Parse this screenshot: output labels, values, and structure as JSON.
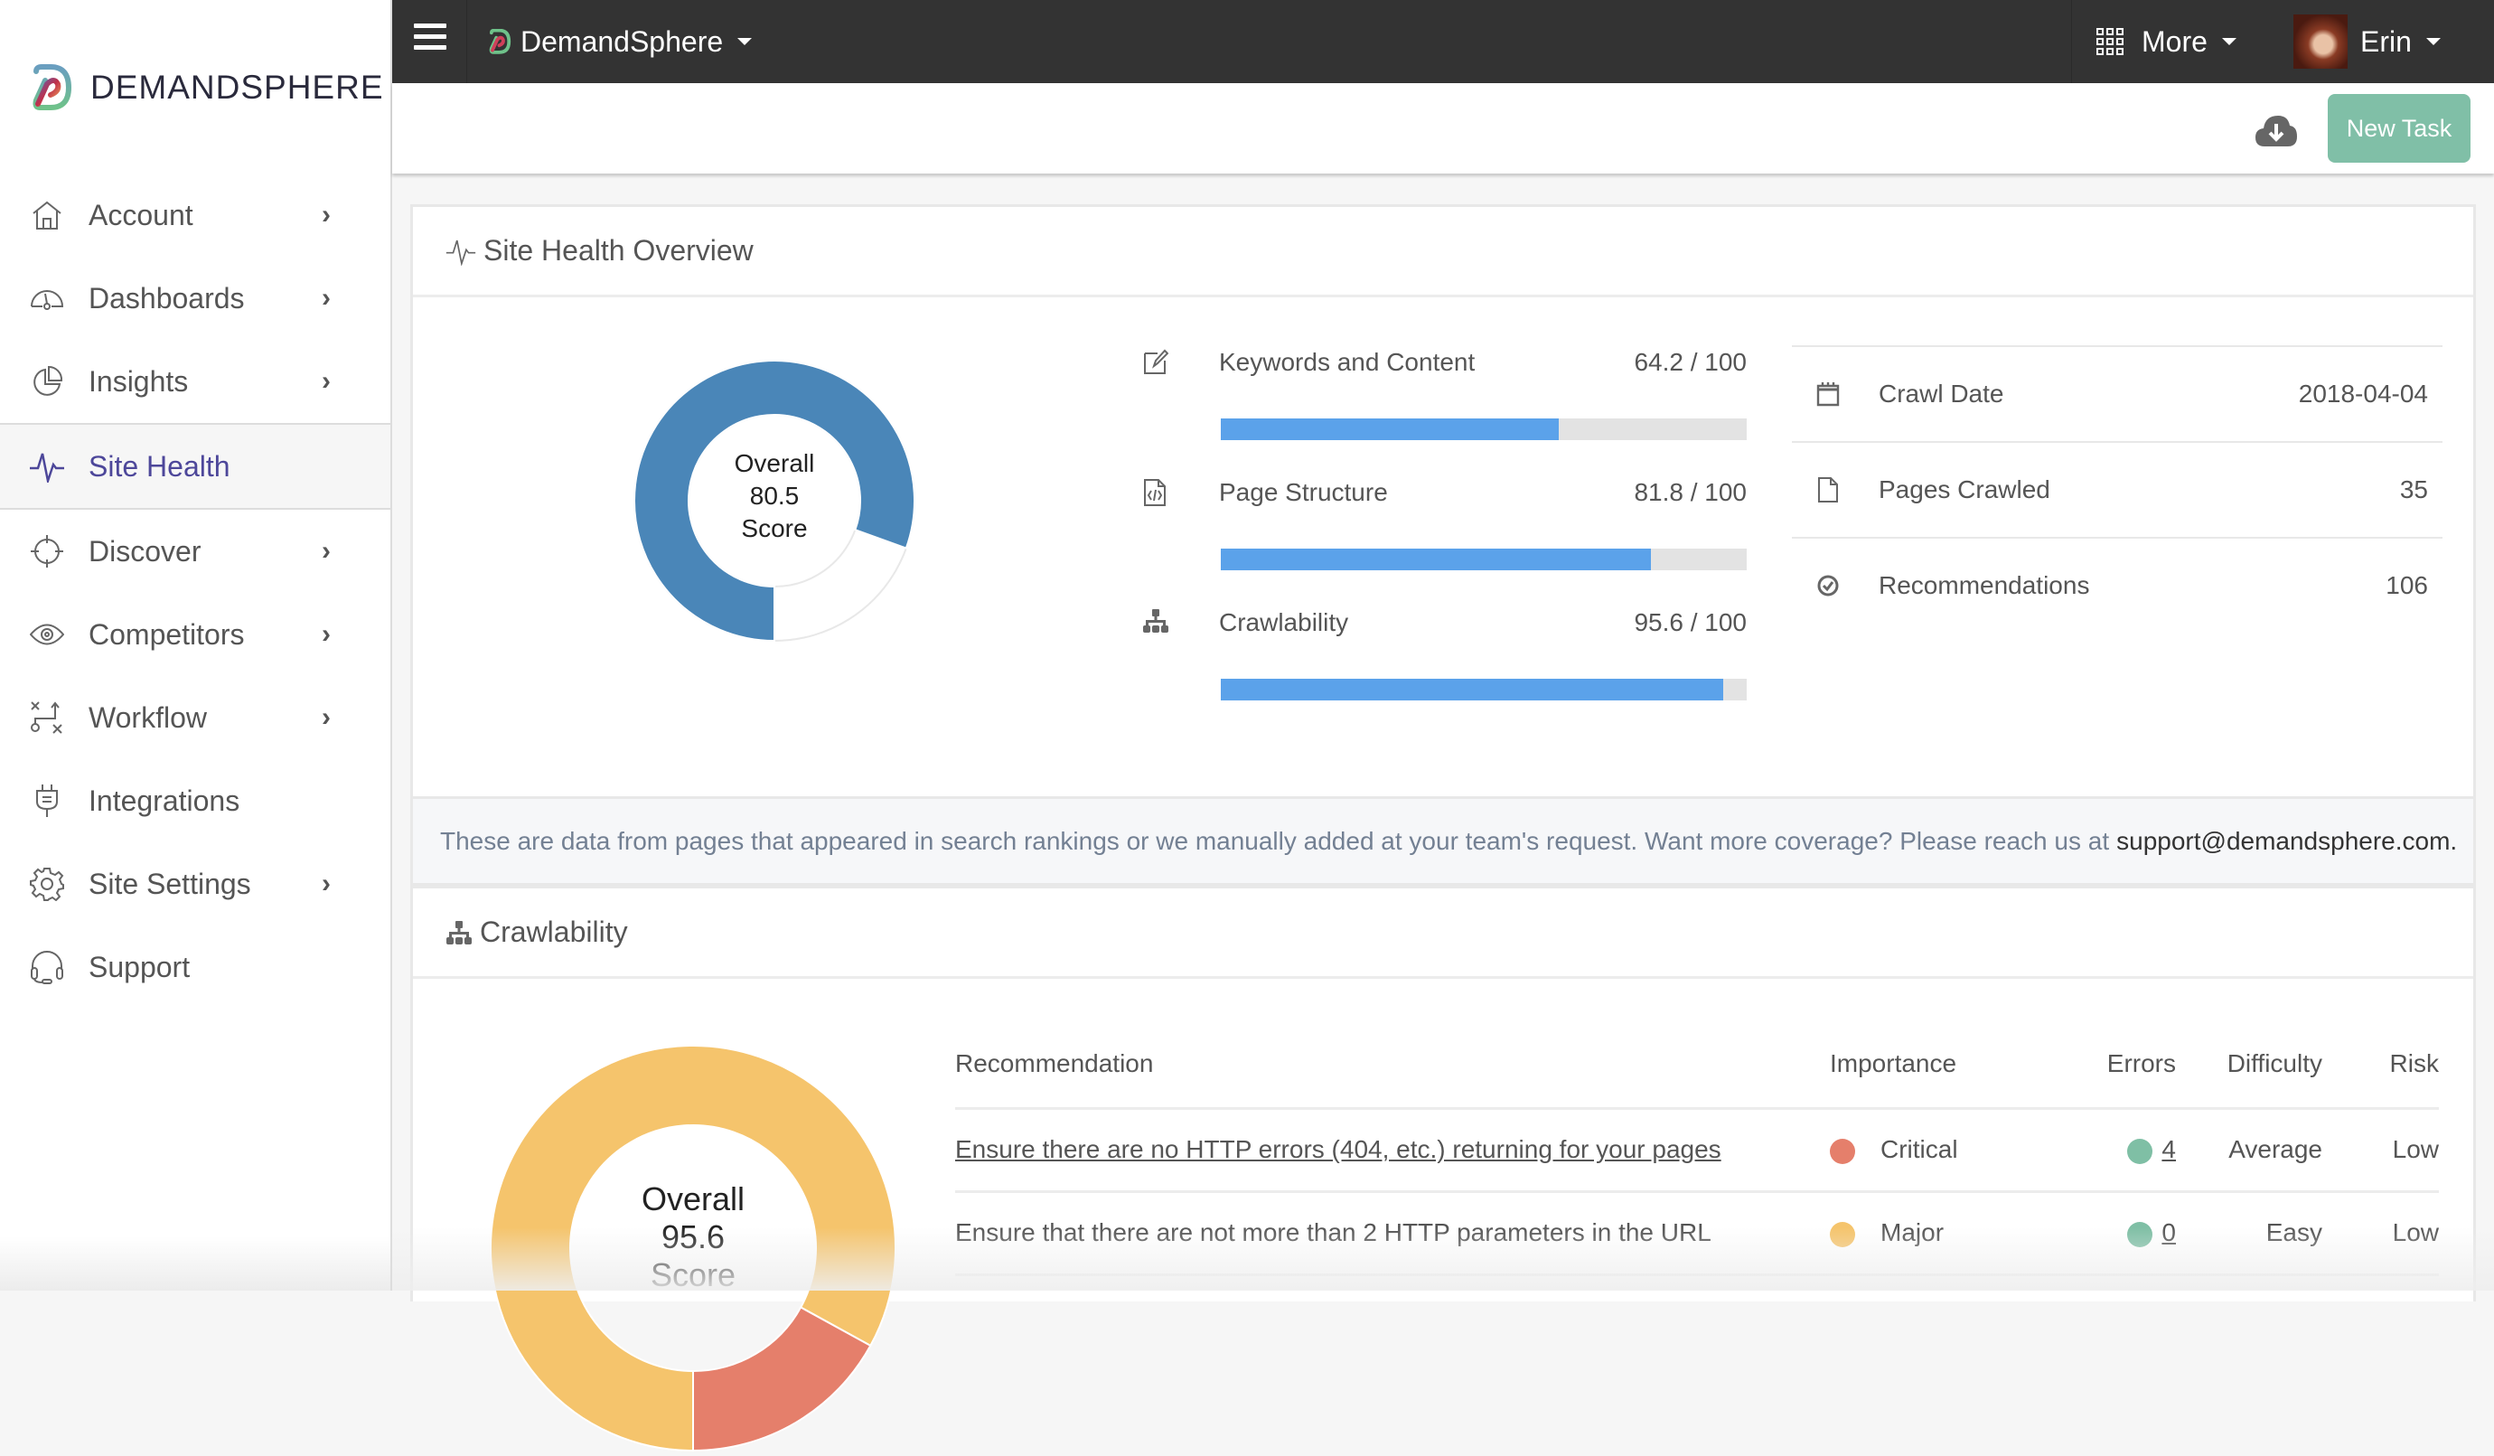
{
  "brand": {
    "name": "DEMANDSPHERE"
  },
  "sidebar": {
    "items": [
      {
        "label": "Account",
        "icon": "home-icon",
        "has_submenu": true,
        "active": false
      },
      {
        "label": "Dashboards",
        "icon": "gauge-icon",
        "has_submenu": true,
        "active": false
      },
      {
        "label": "Insights",
        "icon": "pie-chart-icon",
        "has_submenu": true,
        "active": false
      },
      {
        "label": "Site Health",
        "icon": "pulse-icon",
        "has_submenu": false,
        "active": true
      },
      {
        "label": "Discover",
        "icon": "crosshair-icon",
        "has_submenu": true,
        "active": false
      },
      {
        "label": "Competitors",
        "icon": "eye-icon",
        "has_submenu": true,
        "active": false
      },
      {
        "label": "Workflow",
        "icon": "strategy-icon",
        "has_submenu": true,
        "active": false
      },
      {
        "label": "Integrations",
        "icon": "plug-icon",
        "has_submenu": false,
        "active": false
      },
      {
        "label": "Site Settings",
        "icon": "gear-icon",
        "has_submenu": true,
        "active": false
      },
      {
        "label": "Support",
        "icon": "headset-icon",
        "has_submenu": false,
        "active": false
      }
    ],
    "chevron": "›"
  },
  "topbar": {
    "site_name": "DemandSphere",
    "more_label": "More",
    "user_name": "Erin"
  },
  "toolbar": {
    "new_task_label": "New Task"
  },
  "overview": {
    "title": "Site Health Overview",
    "score": {
      "line1": "Overall",
      "value": "80.5",
      "line3": "Score",
      "fraction": 0.805,
      "color": "#4a86b8"
    },
    "metrics": [
      {
        "name": "Keywords and Content",
        "value": "64.2 / 100",
        "fraction": 0.642,
        "icon": "edit-icon"
      },
      {
        "name": "Page Structure",
        "value": "81.8 / 100",
        "fraction": 0.818,
        "icon": "code-file-icon"
      },
      {
        "name": "Crawlability",
        "value": "95.6 / 100",
        "fraction": 0.956,
        "icon": "sitemap-icon"
      }
    ],
    "stats": [
      {
        "label": "Crawl Date",
        "value": "2018-04-04",
        "icon": "calendar-icon"
      },
      {
        "label": "Pages Crawled",
        "value": "35",
        "icon": "file-icon"
      },
      {
        "label": "Recommendations",
        "value": "106",
        "icon": "check-circle-icon"
      }
    ],
    "info_text": "These are data from pages that appeared in search rankings or we manually added at your team's request. Want more coverage? Please reach us at",
    "info_email": "support@demandsphere.com."
  },
  "crawlability": {
    "title": "Crawlability",
    "score": {
      "line1": "Overall",
      "value": "95.6",
      "line3": "Score",
      "segments": [
        {
          "name": "Major",
          "fraction": 0.83,
          "color": "#f5c46c"
        },
        {
          "name": "Critical",
          "fraction": 0.17,
          "color": "#e57f6b"
        }
      ]
    },
    "table": {
      "headers": [
        "Recommendation",
        "Importance",
        "Errors",
        "Difficulty",
        "Risk"
      ],
      "rows": [
        {
          "recommendation": "Ensure there are no HTTP errors (404, etc.) returning for your pages",
          "linked": true,
          "importance": "Critical",
          "importance_color": "#e57f6b",
          "errors": "4",
          "errors_color": "#7fbfa5",
          "difficulty": "Average",
          "risk": "Low"
        },
        {
          "recommendation": "Ensure that there are not more than 2 HTTP parameters in the URL",
          "linked": false,
          "importance": "Major",
          "importance_color": "#f5c46c",
          "errors": "0",
          "errors_color": "#7fbfa5",
          "difficulty": "Easy",
          "risk": "Low"
        }
      ]
    }
  }
}
